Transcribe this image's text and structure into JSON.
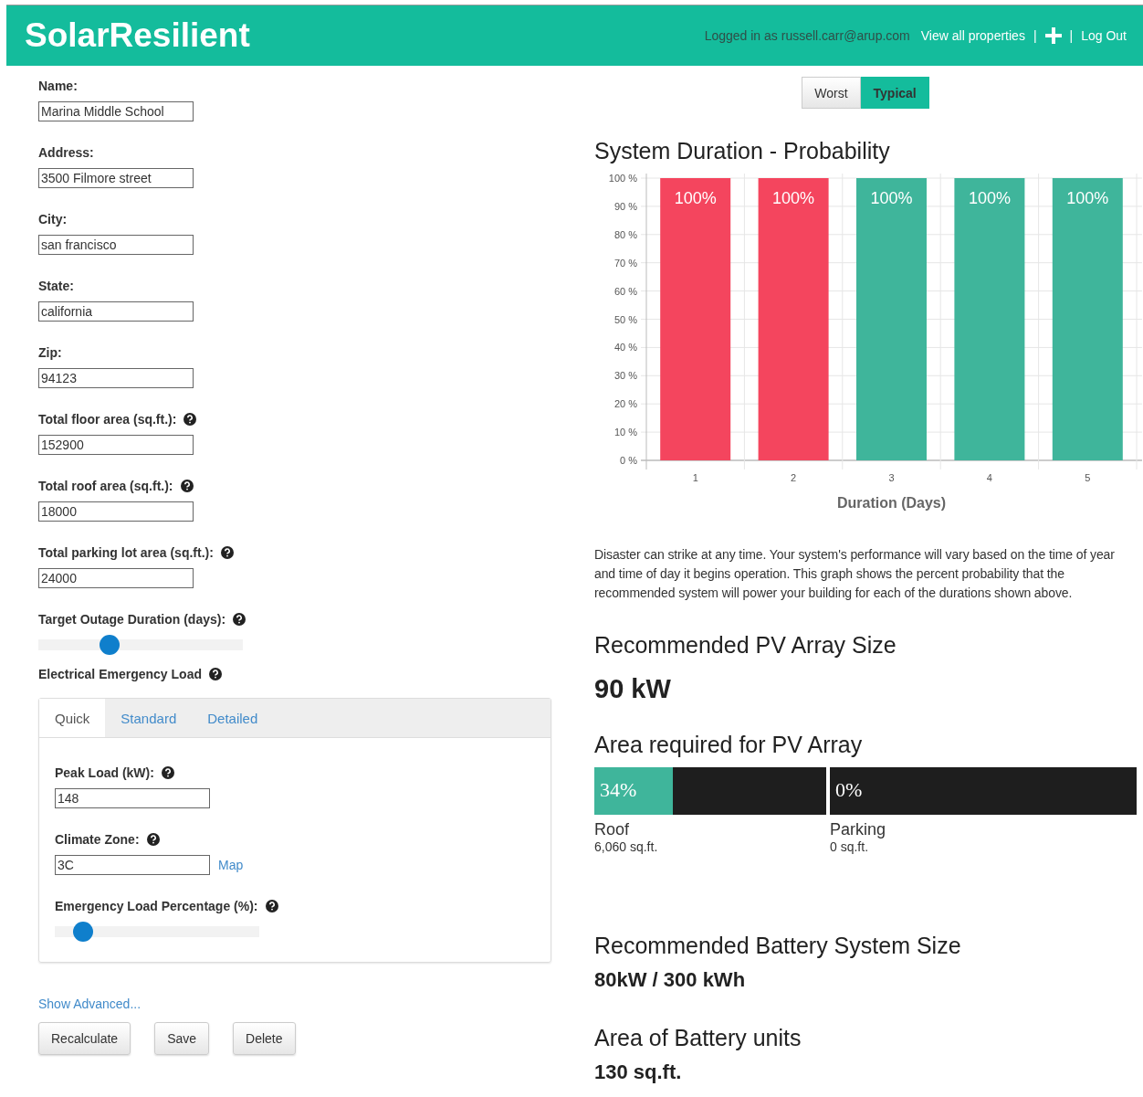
{
  "header": {
    "logo": "SolarResilient",
    "logged_in": "Logged in as russell.carr@arup.com",
    "nav": [
      {
        "kind": "link",
        "label": "View all properties"
      },
      {
        "kind": "separator",
        "label": "|"
      },
      {
        "kind": "add"
      },
      {
        "kind": "separator",
        "label": "|"
      },
      {
        "kind": "link",
        "label": "Log Out"
      }
    ]
  },
  "form": {
    "fields": [
      {
        "label": "Name:",
        "value": "Marina Middle School",
        "help": false
      },
      {
        "label": "Address:",
        "value": "3500 Filmore street",
        "help": false
      },
      {
        "label": "City:",
        "value": "san francisco",
        "help": false
      },
      {
        "label": "State:",
        "value": "california",
        "help": false
      },
      {
        "label": "Zip:",
        "value": "94123",
        "help": false
      },
      {
        "label": "Total floor area (sq.ft.):",
        "value": "152900",
        "help": true
      },
      {
        "label": "Total roof area (sq.ft.):",
        "value": "18000",
        "help": true
      },
      {
        "label": "Total parking lot area (sq.ft.):",
        "value": "24000",
        "help": true
      }
    ],
    "outage": {
      "label": "Target Outage Duration (days):",
      "help": true,
      "level": 0.33
    },
    "load": {
      "label": "Electrical Emergency Load",
      "help": true,
      "tabs": [
        {
          "label": "Quick",
          "selected": true
        },
        {
          "label": "Standard",
          "selected": false
        },
        {
          "label": "Detailed",
          "selected": false
        }
      ],
      "fields": [
        {
          "kind": "input",
          "label": "Peak Load (kW):",
          "help": true,
          "value": "148"
        },
        {
          "kind": "input",
          "label": "Climate Zone:",
          "help": true,
          "value": "3C",
          "link": "Map"
        },
        {
          "kind": "slider",
          "label": "Emergency Load Percentage (%):",
          "help": true,
          "level": 0.1
        }
      ]
    },
    "show_advanced": "Show Advanced...",
    "buttons": [
      "Recalculate",
      "Save",
      "Delete"
    ]
  },
  "results": {
    "scenario": [
      {
        "label": "Worst",
        "selected": false
      },
      {
        "label": "Typical",
        "selected": true
      }
    ],
    "chart": {
      "title": "System Duration - Probability",
      "chart_data": {
        "type": "bar",
        "xlabel": "Duration (Days)",
        "categories": [
          "1",
          "2",
          "3",
          "4",
          "5"
        ],
        "series": [
          {
            "color": "#f4455e",
            "values": [
              100,
              100,
              null,
              null,
              null
            ]
          },
          {
            "color": "#3fb59b",
            "values": [
              null,
              null,
              100,
              100,
              100
            ]
          }
        ],
        "stacked": true,
        "grid": true,
        "ylim": [
          0,
          100
        ],
        "yticks": [
          {
            "value": 0,
            "label": "0 %"
          },
          {
            "value": 10,
            "label": "10 %"
          },
          {
            "value": 20,
            "label": "20 %"
          },
          {
            "value": 30,
            "label": "30 %"
          },
          {
            "value": 40,
            "label": "40 %"
          },
          {
            "value": 50,
            "label": "50 %"
          },
          {
            "value": 60,
            "label": "60 %"
          },
          {
            "value": 70,
            "label": "70 %"
          },
          {
            "value": 80,
            "label": "80 %"
          },
          {
            "value": 90,
            "label": "90 %"
          },
          {
            "value": 100,
            "label": "100 %"
          }
        ],
        "value_labels": [
          "100%",
          "100%",
          "100%",
          "100%",
          "100%"
        ]
      }
    },
    "description": "Disaster can strike at any time. Your system's performance will vary based on the time of year and time of day it begins operation. This graph shows the percent probability that the recommended system will power your building for each of the durations shown above.",
    "pv": {
      "title": "Recommended PV Array Size",
      "value": "90 kW"
    },
    "area": {
      "title": "Area required for PV Array",
      "segments": [
        {
          "percent": "34%",
          "level": 0.34,
          "label": "Roof",
          "area": "6,060 sq.ft."
        },
        {
          "percent": "0%",
          "level": 0,
          "label": "Parking",
          "area": "0 sq.ft."
        }
      ]
    },
    "battery": {
      "title": "Recommended Battery System Size",
      "value": "80kW / 300 kWh"
    },
    "battery_area": {
      "title": "Area of Battery units",
      "value": "130 sq.ft."
    }
  }
}
